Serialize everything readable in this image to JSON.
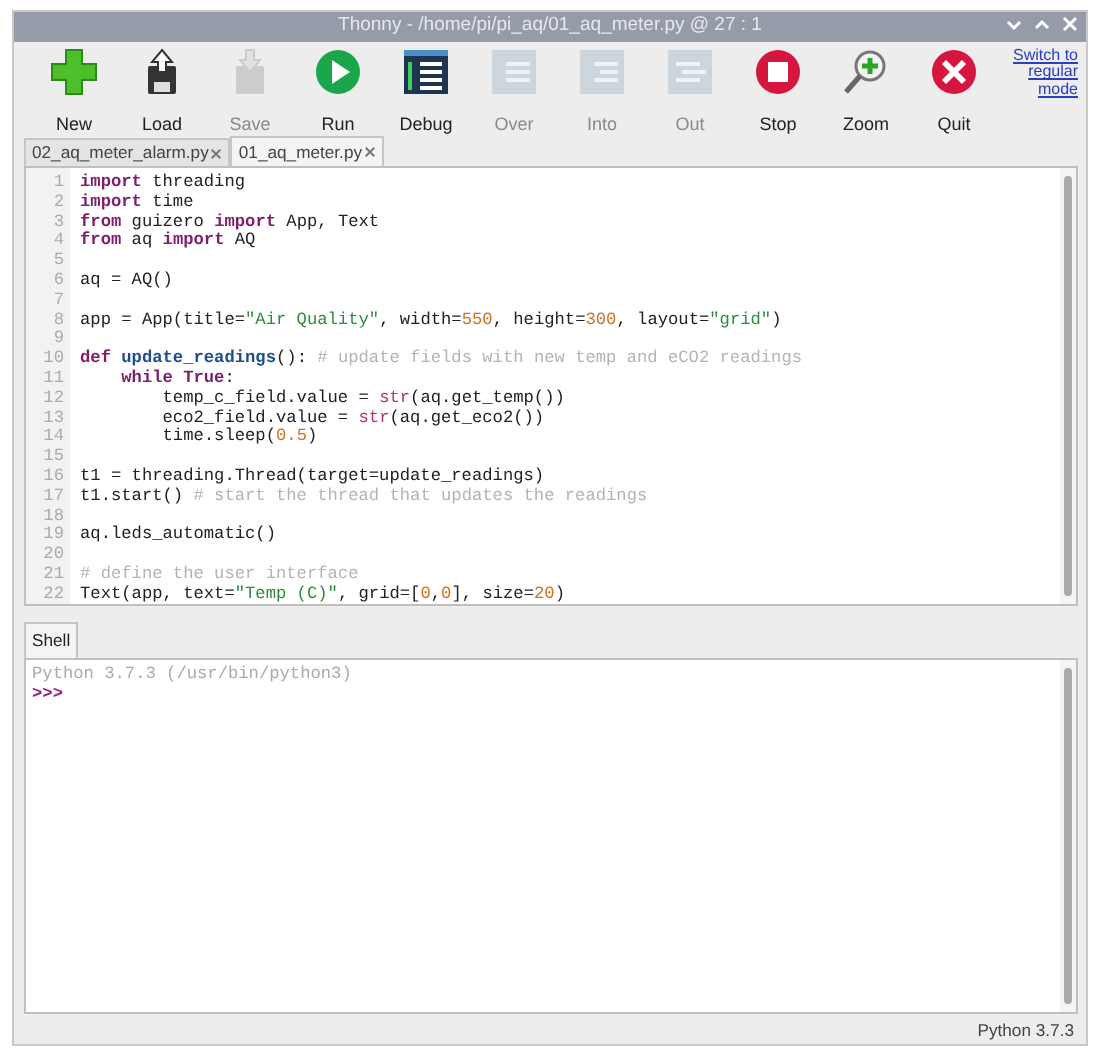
{
  "window": {
    "title": "Thonny  -  /home/pi/pi_aq/01_aq_meter.py  @  27 : 1"
  },
  "toolbar": [
    {
      "label": "New",
      "kind": "new",
      "disabled": false
    },
    {
      "label": "Load",
      "kind": "load",
      "disabled": false
    },
    {
      "label": "Save",
      "kind": "save",
      "disabled": true
    },
    {
      "label": "Run",
      "kind": "run",
      "disabled": false
    },
    {
      "label": "Debug",
      "kind": "debug",
      "disabled": false
    },
    {
      "label": "Over",
      "kind": "over",
      "disabled": true
    },
    {
      "label": "Into",
      "kind": "into",
      "disabled": true
    },
    {
      "label": "Out",
      "kind": "out",
      "disabled": true
    },
    {
      "label": "Stop",
      "kind": "stop",
      "disabled": false
    },
    {
      "label": "Zoom",
      "kind": "zoom",
      "disabled": false
    },
    {
      "label": "Quit",
      "kind": "quit",
      "disabled": false
    }
  ],
  "mode_link": "Switch to regular mode",
  "editor_tabs": [
    {
      "label": "02_aq_meter_alarm.py",
      "selected": false
    },
    {
      "label": "01_aq_meter.py",
      "selected": true
    }
  ],
  "code_lines": [
    {
      "number": "1",
      "tokens": [
        {
          "kind": "keyword",
          "text": "import"
        },
        {
          "kind": "plain",
          "text": " threading"
        }
      ]
    },
    {
      "number": "2",
      "tokens": [
        {
          "kind": "keyword",
          "text": "import"
        },
        {
          "kind": "plain",
          "text": " time"
        }
      ]
    },
    {
      "number": "3",
      "tokens": [
        {
          "kind": "keyword",
          "text": "from"
        },
        {
          "kind": "plain",
          "text": " guizero "
        },
        {
          "kind": "keyword",
          "text": "import"
        },
        {
          "kind": "plain",
          "text": " App, Text"
        }
      ]
    },
    {
      "number": "4",
      "tokens": [
        {
          "kind": "keyword",
          "text": "from"
        },
        {
          "kind": "plain",
          "text": " aq "
        },
        {
          "kind": "keyword",
          "text": "import"
        },
        {
          "kind": "plain",
          "text": " AQ"
        }
      ]
    },
    {
      "number": "5"
    },
    {
      "number": "6",
      "tokens": [
        {
          "kind": "plain",
          "text": "aq = AQ()"
        }
      ]
    },
    {
      "number": "7"
    },
    {
      "number": "8",
      "tokens": [
        {
          "kind": "plain",
          "text": "app = App(title="
        },
        {
          "kind": "string",
          "text": "\"Air Quality\""
        },
        {
          "kind": "plain",
          "text": ", width="
        },
        {
          "kind": "number",
          "text": "550"
        },
        {
          "kind": "plain",
          "text": ", height="
        },
        {
          "kind": "number",
          "text": "300"
        },
        {
          "kind": "plain",
          "text": ", layout="
        },
        {
          "kind": "string",
          "text": "\"grid\""
        },
        {
          "kind": "plain",
          "text": ")"
        }
      ]
    },
    {
      "number": "9"
    },
    {
      "number": "10",
      "tokens": [
        {
          "kind": "keyword",
          "text": "def"
        },
        {
          "kind": "defname",
          "text": " update_readings"
        },
        {
          "kind": "plain",
          "text": "(): "
        },
        {
          "kind": "comment",
          "text": "# update fields with new temp and eCO2 readings"
        }
      ]
    },
    {
      "number": "11",
      "tokens": [
        {
          "kind": "keyword",
          "text": "    while True"
        },
        {
          "kind": "plain",
          "text": ":"
        }
      ]
    },
    {
      "number": "12",
      "tokens": [
        {
          "kind": "plain",
          "text": "        temp_c_field.value = "
        },
        {
          "kind": "builtin",
          "text": "str"
        },
        {
          "kind": "plain",
          "text": "(aq.get_temp())"
        }
      ]
    },
    {
      "number": "13",
      "tokens": [
        {
          "kind": "plain",
          "text": "        eco2_field.value = "
        },
        {
          "kind": "builtin",
          "text": "str"
        },
        {
          "kind": "plain",
          "text": "(aq.get_eco2())"
        }
      ]
    },
    {
      "number": "14",
      "tokens": [
        {
          "kind": "plain",
          "text": "        time.sleep("
        },
        {
          "kind": "number",
          "text": "0.5"
        },
        {
          "kind": "plain",
          "text": ")"
        }
      ]
    },
    {
      "number": "15"
    },
    {
      "number": "16",
      "tokens": [
        {
          "kind": "plain",
          "text": "t1 = threading.Thread(target=update_readings)"
        }
      ]
    },
    {
      "number": "17",
      "tokens": [
        {
          "kind": "plain",
          "text": "t1.start() "
        },
        {
          "kind": "comment",
          "text": "# start the thread that updates the readings"
        }
      ]
    },
    {
      "number": "18"
    },
    {
      "number": "19",
      "tokens": [
        {
          "kind": "plain",
          "text": "aq.leds_automatic()"
        }
      ]
    },
    {
      "number": "20"
    },
    {
      "number": "21",
      "tokens": [
        {
          "kind": "comment",
          "text": "# define the user interface"
        }
      ]
    },
    {
      "number": "22",
      "tokens": [
        {
          "kind": "plain",
          "text": "Text(app, text="
        },
        {
          "kind": "string",
          "text": "\"Temp (C)\""
        },
        {
          "kind": "plain",
          "text": ", grid=["
        },
        {
          "kind": "number",
          "text": "0"
        },
        {
          "kind": "plain",
          "text": ","
        },
        {
          "kind": "number",
          "text": "0"
        },
        {
          "kind": "plain",
          "text": "], size="
        },
        {
          "kind": "number",
          "text": "20"
        },
        {
          "kind": "plain",
          "text": ")"
        }
      ]
    }
  ],
  "shell": {
    "tab": "Shell",
    "banner": "Python 3.7.3 (/usr/bin/python3)",
    "prompt": ">>>"
  },
  "status_bar": "Python 3.7.3"
}
